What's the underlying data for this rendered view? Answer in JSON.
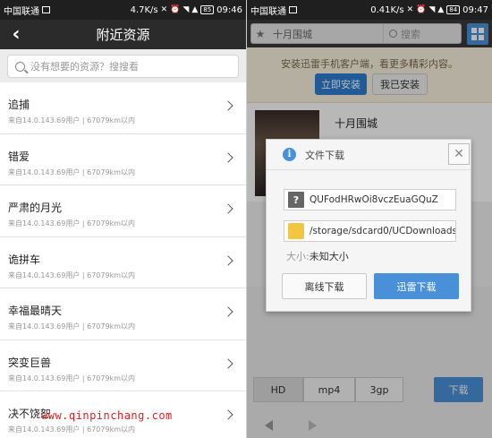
{
  "left": {
    "statusbar": {
      "carrier": "中国联通",
      "speed": "4.7K/s",
      "battery": "85",
      "time": "09:46"
    },
    "navbar": {
      "back_icon": "back-arrow-icon",
      "title": "附近资源"
    },
    "search": {
      "placeholder": "没有想要的资源？搜搜看"
    },
    "items": [
      {
        "title": "追捕",
        "meta": "来自14.0.143.69用户 | 67079km以内"
      },
      {
        "title": "错爱",
        "meta": "来自14.0.143.69用户 | 67079km以内"
      },
      {
        "title": "严肃的月光",
        "meta": "来自14.0.143.69用户 | 67079km以内"
      },
      {
        "title": "诡拼车",
        "meta": "来自14.0.143.69用户 | 67079km以内"
      },
      {
        "title": "幸福最晴天",
        "meta": "来自14.0.143.69用户 | 67079km以内"
      },
      {
        "title": "突变巨兽",
        "meta": "来自14.0.143.69用户 | 67079km以内"
      },
      {
        "title": "决不饶恕",
        "meta": "来自14.0.143.69用户 | 67079km以内"
      }
    ]
  },
  "right": {
    "statusbar": {
      "carrier": "中国联通",
      "speed": "0.41K/s",
      "battery": "84",
      "time": "09:47"
    },
    "toolbar": {
      "url_text": "十月围城",
      "search_label": "搜索"
    },
    "banner": {
      "text": "安装迅雷手机客户端，看更多精彩内容。",
      "install_label": "立即安装",
      "installed_label": "我已安装"
    },
    "movie": {
      "title": "十月围城"
    },
    "quality": {
      "hd": "HD",
      "mp4": "mp4",
      "p3": "3gp"
    },
    "download_label": "下载",
    "dialog": {
      "title": "文件下载",
      "file_name": "QUFodHRwOi8vczEuaGQuZ",
      "path": "/storage/sdcard0/UCDownloads",
      "size_label": "大小:",
      "size_value": "未知大小",
      "offline_label": "离线下载",
      "xunlei_label": "迅雷下载"
    }
  },
  "watermark": "www.qinpinchang.com",
  "colors": {
    "accent_blue": "#4a90d9",
    "install_blue": "#2f7fd1",
    "banner_bg": "#fbf3df"
  }
}
